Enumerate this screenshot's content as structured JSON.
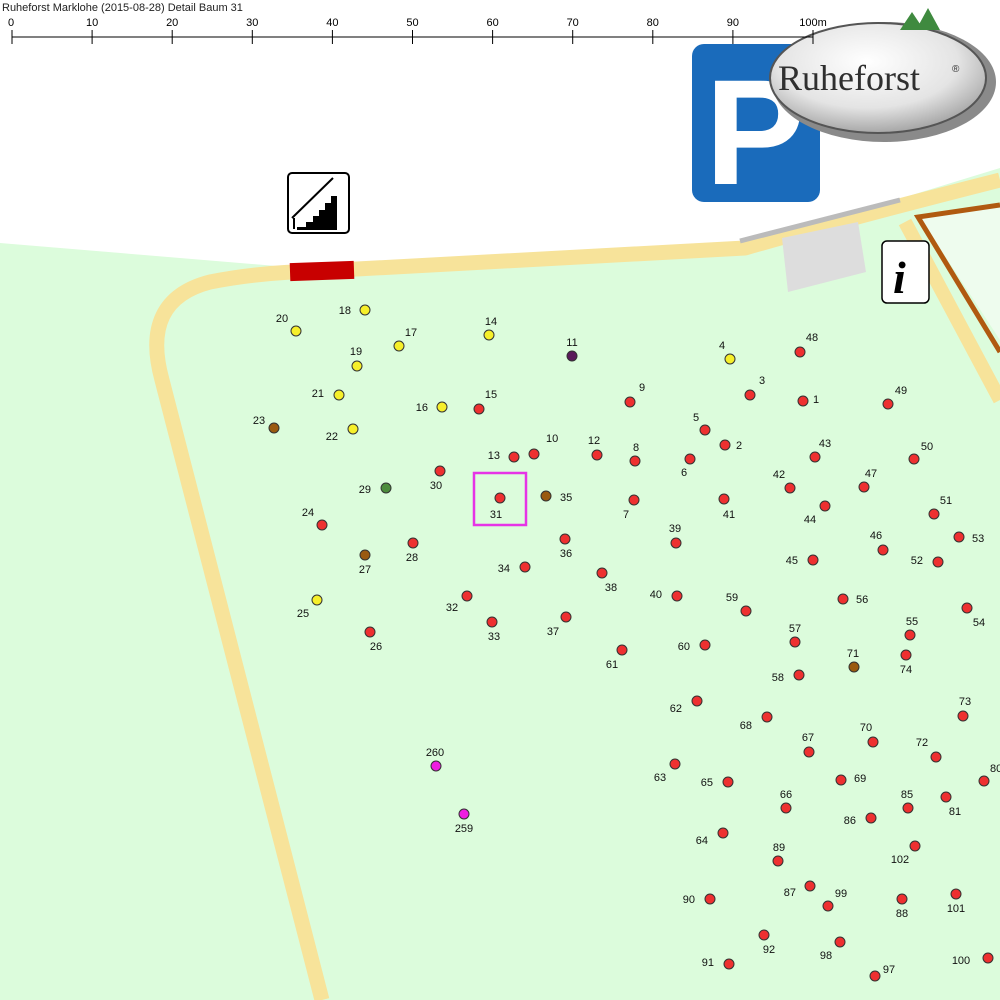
{
  "title": "Ruheforst Marklohe (2015-08-28) Detail  Baum 31",
  "scale": {
    "ticks": [
      "0",
      "10",
      "20",
      "30",
      "40",
      "50",
      "60",
      "70",
      "80",
      "90",
      "100m"
    ]
  },
  "logo": {
    "text": "Ruheforst",
    "registered": "®"
  },
  "icons": {
    "info": "i",
    "parking": "P",
    "stairs": "stairs-icon",
    "parking_icon": "parking-icon",
    "info_icon": "info-icon"
  },
  "colors": {
    "forest": "#dcfcdc",
    "path": "#f7e39a",
    "tree_red": "#ee3030",
    "tree_yellow": "#f6ef2a",
    "tree_brown": "#9a5a10",
    "tree_green": "#4c8c3c",
    "tree_purple": "#5a1a5a",
    "tree_magenta": "#ee1ee0",
    "highlight": "#e633e6",
    "gate": "#c80000",
    "parking_blue": "#1a6bbb"
  },
  "selected_tree": "31",
  "trees": [
    {
      "id": "1",
      "color": "red"
    },
    {
      "id": "2",
      "color": "red"
    },
    {
      "id": "3",
      "color": "red"
    },
    {
      "id": "4",
      "color": "yellow"
    },
    {
      "id": "5",
      "color": "red"
    },
    {
      "id": "6",
      "color": "red"
    },
    {
      "id": "7",
      "color": "red"
    },
    {
      "id": "8",
      "color": "red"
    },
    {
      "id": "9",
      "color": "red"
    },
    {
      "id": "10",
      "color": "red"
    },
    {
      "id": "11",
      "color": "purple"
    },
    {
      "id": "12",
      "color": "red"
    },
    {
      "id": "13",
      "color": "red"
    },
    {
      "id": "14",
      "color": "yellow"
    },
    {
      "id": "15",
      "color": "red"
    },
    {
      "id": "16",
      "color": "yellow"
    },
    {
      "id": "17",
      "color": "yellow"
    },
    {
      "id": "18",
      "color": "yellow"
    },
    {
      "id": "19",
      "color": "yellow"
    },
    {
      "id": "20",
      "color": "yellow"
    },
    {
      "id": "21",
      "color": "yellow"
    },
    {
      "id": "22",
      "color": "yellow"
    },
    {
      "id": "23",
      "color": "brown"
    },
    {
      "id": "24",
      "color": "red"
    },
    {
      "id": "25",
      "color": "yellow"
    },
    {
      "id": "26",
      "color": "red"
    },
    {
      "id": "27",
      "color": "brown"
    },
    {
      "id": "28",
      "color": "red"
    },
    {
      "id": "29",
      "color": "green"
    },
    {
      "id": "30",
      "color": "red"
    },
    {
      "id": "31",
      "color": "red"
    },
    {
      "id": "32",
      "color": "red"
    },
    {
      "id": "33",
      "color": "red"
    },
    {
      "id": "34",
      "color": "red"
    },
    {
      "id": "35",
      "color": "brown"
    },
    {
      "id": "36",
      "color": "red"
    },
    {
      "id": "37",
      "color": "red"
    },
    {
      "id": "38",
      "color": "red"
    },
    {
      "id": "39",
      "color": "red"
    },
    {
      "id": "40",
      "color": "red"
    },
    {
      "id": "41",
      "color": "red"
    },
    {
      "id": "42",
      "color": "red"
    },
    {
      "id": "43",
      "color": "red"
    },
    {
      "id": "44",
      "color": "red"
    },
    {
      "id": "45",
      "color": "red"
    },
    {
      "id": "46",
      "color": "red"
    },
    {
      "id": "47",
      "color": "red"
    },
    {
      "id": "48",
      "color": "red"
    },
    {
      "id": "49",
      "color": "red"
    },
    {
      "id": "50",
      "color": "red"
    },
    {
      "id": "51",
      "color": "red"
    },
    {
      "id": "52",
      "color": "red"
    },
    {
      "id": "53",
      "color": "red"
    },
    {
      "id": "54",
      "color": "red"
    },
    {
      "id": "55",
      "color": "red"
    },
    {
      "id": "56",
      "color": "red"
    },
    {
      "id": "57",
      "color": "red"
    },
    {
      "id": "58",
      "color": "red"
    },
    {
      "id": "59",
      "color": "red"
    },
    {
      "id": "60",
      "color": "red"
    },
    {
      "id": "61",
      "color": "red"
    },
    {
      "id": "62",
      "color": "red"
    },
    {
      "id": "63",
      "color": "red"
    },
    {
      "id": "64",
      "color": "red"
    },
    {
      "id": "65",
      "color": "red"
    },
    {
      "id": "66",
      "color": "red"
    },
    {
      "id": "67",
      "color": "red"
    },
    {
      "id": "68",
      "color": "red"
    },
    {
      "id": "69",
      "color": "red"
    },
    {
      "id": "70",
      "color": "red"
    },
    {
      "id": "71",
      "color": "brown"
    },
    {
      "id": "72",
      "color": "red"
    },
    {
      "id": "73",
      "color": "red"
    },
    {
      "id": "74",
      "color": "red"
    },
    {
      "id": "80",
      "color": "red"
    },
    {
      "id": "81",
      "color": "red"
    },
    {
      "id": "85",
      "color": "red"
    },
    {
      "id": "86",
      "color": "red"
    },
    {
      "id": "87",
      "color": "red"
    },
    {
      "id": "88",
      "color": "red"
    },
    {
      "id": "89",
      "color": "red"
    },
    {
      "id": "90",
      "color": "red"
    },
    {
      "id": "91",
      "color": "red"
    },
    {
      "id": "92",
      "color": "red"
    },
    {
      "id": "97",
      "color": "red"
    },
    {
      "id": "98",
      "color": "red"
    },
    {
      "id": "99",
      "color": "red"
    },
    {
      "id": "100",
      "color": "red"
    },
    {
      "id": "101",
      "color": "red"
    },
    {
      "id": "102",
      "color": "red"
    },
    {
      "id": "259",
      "color": "magenta"
    },
    {
      "id": "260",
      "color": "magenta"
    }
  ]
}
